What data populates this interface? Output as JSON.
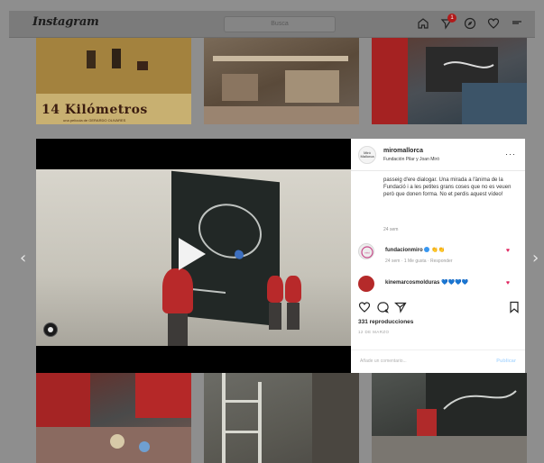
{
  "header": {
    "logo": "Instagram",
    "search_placeholder": "Busca",
    "messages_badge": "1",
    "icons": [
      "home-icon",
      "direct-icon",
      "explore-icon",
      "heart-icon",
      "avatar"
    ]
  },
  "grid": {
    "tile1_title": "14 Kilómetros",
    "tile1_credits": "una película de GERARDO OLIVARES"
  },
  "post": {
    "username": "miromallorca",
    "subtitle": "Fundación Pilar y Joan Miró",
    "avatar_label": "Miró Mallorca",
    "caption": "passeig d'ere dialogar. Una mirada a l'ànima de la Fundació i a les petites grans coses que no es veuen però que donen forma. No et perdis aquest vídeo!",
    "caption_time": "24 sem",
    "comments": [
      {
        "user": "fundacionmiro",
        "verified": true,
        "emoji": "👏👏",
        "meta": "24 sem · 1 Me gusta · Responder",
        "avatar_color": "#e8e8e8"
      },
      {
        "user": "kinemarcosmolduras",
        "verified": false,
        "emoji": "💙💙💙💙",
        "meta": "",
        "avatar_color": "#b52a2a"
      }
    ],
    "views": "331 reproducciones",
    "date": "12 DE MARZO",
    "add_comment_placeholder": "Añade un comentario...",
    "publish_label": "Publicar"
  },
  "colors": {
    "overlay": "#8e8e8e",
    "like_red": "#e0245e",
    "link_blue": "#b3dbff"
  }
}
